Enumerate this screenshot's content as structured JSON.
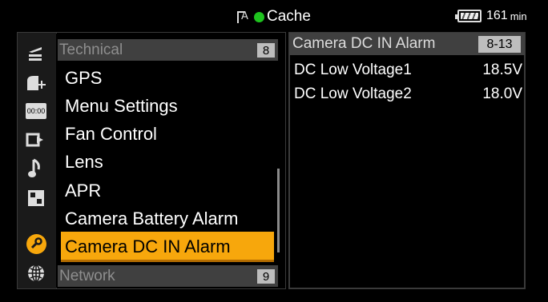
{
  "status_bar": {
    "media_icon": "media-a-icon",
    "cache_indicator_color": "#1ec31e",
    "cache_label": "Cache",
    "battery_icon": "battery-icon",
    "battery_remaining": "161",
    "battery_unit": "min"
  },
  "sidebar_icons": [
    {
      "name": "camera-icon",
      "glyph": "⭍"
    },
    {
      "name": "paint-icon",
      "glyph": "◢"
    },
    {
      "name": "timecode-icon",
      "glyph": "00:00"
    },
    {
      "name": "output-icon",
      "glyph": "⮕"
    },
    {
      "name": "audio-icon",
      "glyph": "♪"
    },
    {
      "name": "thumbnail-icon",
      "glyph": "▣"
    },
    {
      "name": "maintenance-icon",
      "glyph": "🔧"
    },
    {
      "name": "network-icon",
      "glyph": "🌐"
    }
  ],
  "menu": {
    "category_top": {
      "label": "Technical",
      "badge": "8"
    },
    "items": [
      {
        "label": "GPS"
      },
      {
        "label": "Menu Settings"
      },
      {
        "label": "Fan Control"
      },
      {
        "label": "Lens"
      },
      {
        "label": "APR"
      },
      {
        "label": "Camera Battery Alarm"
      },
      {
        "label": "Camera DC IN Alarm",
        "selected": true
      }
    ],
    "category_bottom": {
      "label": "Network",
      "badge": "9"
    },
    "accent_color": "#f7a70c"
  },
  "detail": {
    "title": "Camera DC IN Alarm",
    "code": "8-13",
    "rows": [
      {
        "label": "DC Low Voltage1",
        "value": "18.5V"
      },
      {
        "label": "DC Low Voltage2",
        "value": "18.0V"
      }
    ]
  }
}
